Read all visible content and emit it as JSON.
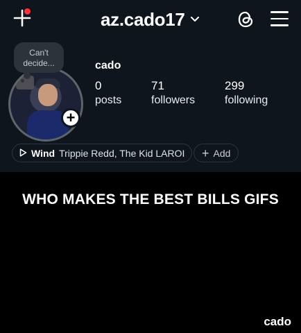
{
  "header": {
    "username": "az.cado17"
  },
  "profile": {
    "note_line1": "Can't",
    "note_line2": "decide...",
    "display_name": "cado",
    "stats": [
      {
        "value": "0",
        "label": "posts"
      },
      {
        "value": "71",
        "label": "followers"
      },
      {
        "value": "299",
        "label": "following"
      }
    ],
    "music": {
      "song": "Wind",
      "artist": "Trippie Redd, The Kid LAROI"
    },
    "add_label": "Add",
    "add_story_symbol": "+"
  },
  "video": {
    "caption": "WHO MAKES THE BEST BILLS GIFS",
    "watermark": "cado"
  },
  "colors": {
    "background": "#0f151d",
    "notification_dot": "#ff3040",
    "note_bubble": "#2c333b"
  },
  "icons": [
    "new-post-icon",
    "chevron-down-icon",
    "threads-icon",
    "menu-icon",
    "play-icon"
  ]
}
